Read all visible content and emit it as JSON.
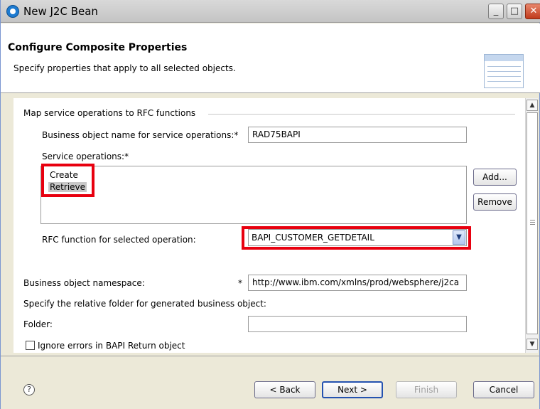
{
  "window": {
    "title": "New J2C Bean",
    "controls": [
      "minimize",
      "maximize",
      "close"
    ]
  },
  "banner": {
    "title": "Configure Composite Properties",
    "description": "Specify properties that apply to all selected objects.",
    "icon": "table-wizard-icon"
  },
  "form": {
    "group_label": "Map service operations to RFC functions",
    "bo_name_label": "Business object name for service operations:",
    "bo_name_required": "*",
    "bo_name_value": "RAD75BAPI",
    "service_ops_label": "Service operations:*",
    "service_ops": [
      "Create",
      "Retrieve"
    ],
    "selected_service_op": "Retrieve",
    "add_label": "Add...",
    "remove_label": "Remove",
    "rfc_label": "RFC function for selected operation:",
    "rfc_value": "BAPI_CUSTOMER_GETDETAIL",
    "namespace_label": "Business object namespace:",
    "namespace_required": "*",
    "namespace_value": "http://www.ibm.com/xmlns/prod/websphere/j2ca",
    "relative_folder_label": "Specify the relative folder for generated business object:",
    "folder_label": "Folder:",
    "folder_value": "",
    "ignore_errors_label": "Ignore errors in BAPI Return object",
    "ignore_errors_checked": false
  },
  "buttons": {
    "back": "< Back",
    "next": "Next >",
    "finish": "Finish",
    "cancel": "Cancel"
  },
  "colors": {
    "highlight": "#e8000f",
    "selection": "#c8c8c8",
    "default_button_border": "#2452b0"
  }
}
